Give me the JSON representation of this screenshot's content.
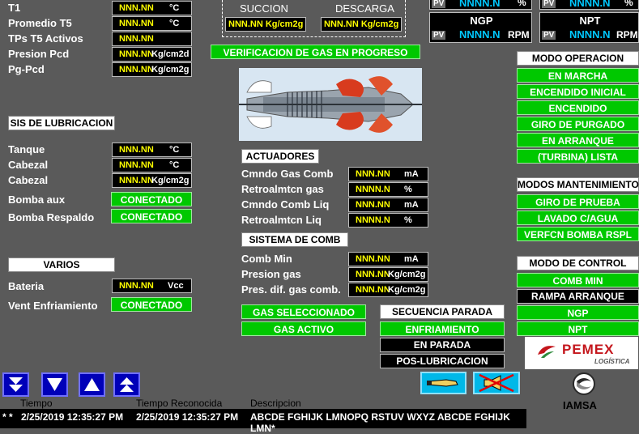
{
  "top_left": {
    "rows": [
      {
        "label": "T1",
        "value": "NNN.NN",
        "unit": "°C"
      },
      {
        "label": "Promedio   T5",
        "value": "NNN.NN",
        "unit": "°C"
      },
      {
        "label": "TPs   T5   Activos",
        "value": "NNN.NN",
        "unit": ""
      },
      {
        "label": "Presion    Pcd",
        "value": "NNN.NN",
        "unit": "Kg/cm2d"
      },
      {
        "label": "Pg-Pcd",
        "value": "NNN.NN",
        "unit": "Kg/cm2g"
      }
    ]
  },
  "pressures": {
    "suction_label": "SUCCION",
    "suction_value": "NNN.NN Kg/cm2g",
    "discharge_label": "DESCARGA",
    "discharge_value": "NNN.NN Kg/cm2g",
    "status": "VERIFICACION DE GAS EN PROGRESO"
  },
  "speeds": {
    "pv": "PV",
    "top_left_value": "NNNN.N",
    "top_left_unit": "%",
    "top_right_value": "NNNN.N",
    "top_right_unit": "%",
    "ngp_label": "NGP",
    "ngp_value": "NNNN.N",
    "ngp_unit": "RPM",
    "npt_label": "NPT",
    "npt_value": "NNNN.N",
    "npt_unit": "RPM"
  },
  "lubrication": {
    "title": "SIS DE LUBRICACION",
    "rows": [
      {
        "label": "Tanque",
        "value": "NNN.NN",
        "unit": "°C"
      },
      {
        "label": "Cabezal",
        "value": "NNN.NN",
        "unit": "°C"
      },
      {
        "label": "Cabezal",
        "value": "NNN.NN",
        "unit": "Kg/cm2g"
      }
    ],
    "bomba_aux_label": "Bomba aux",
    "bomba_aux_state": "CONECTADO",
    "bomba_resp_label": "Bomba Respaldo",
    "bomba_resp_state": "CONECTADO"
  },
  "varios": {
    "title": "VARIOS",
    "bateria_label": "Bateria",
    "bateria_value": "NNN.NN",
    "bateria_unit": "Vcc",
    "vent_label": "Vent Enfriamiento",
    "vent_state": "CONECTADO"
  },
  "actuadores": {
    "title": "ACTUADORES",
    "rows": [
      {
        "label": "Cmndo Gas Comb",
        "value": "NNN.NN",
        "unit": "mA"
      },
      {
        "label": "Retroalmtcn gas",
        "value": "NNNN.N",
        "unit": "%"
      },
      {
        "label": "Cmndo Comb Liq",
        "value": "NNN.NN",
        "unit": "mA"
      },
      {
        "label": "Retroalmtcn Liq",
        "value": "NNNN.N",
        "unit": "%"
      }
    ]
  },
  "sistema_comb": {
    "title": "SISTEMA DE COMB",
    "rows": [
      {
        "label": "Comb  Min",
        "value": "NNN.NN",
        "unit": "mA"
      },
      {
        "label": "Presion  gas",
        "value": "NNN.NN",
        "unit": "Kg/cm2g"
      },
      {
        "label": "Pres. dif. gas comb.",
        "value": "NNN.NN",
        "unit": "Kg/cm2g"
      }
    ]
  },
  "gas_buttons": {
    "seleccionado": "GAS SELECCIONADO",
    "activo": "GAS ACTIVO"
  },
  "secuencia": {
    "title": "SECUENCIA PARADA",
    "items": [
      "ENFRIAMIENTO",
      "EN PARADA",
      "POS-LUBRICACION"
    ]
  },
  "modo_operacion": {
    "title": "MODO OPERACION",
    "items": [
      "EN MARCHA",
      "ENCENDIDO INICIAL",
      "ENCENDIDO",
      "GIRO DE PURGADO",
      "EN ARRANQUE",
      "(TURBINA) LISTA"
    ]
  },
  "modos_mantenimiento": {
    "title": "MODOS MANTENIMIENTO",
    "items": [
      "GIRO DE PRUEBA",
      "LAVADO C/AGUA",
      "VERFCN BOMBA RSPL"
    ]
  },
  "modo_control": {
    "title": "MODO DE CONTROL",
    "items": [
      "COMB MIN",
      "RAMPA ARRANQUE",
      "NGP",
      "NPT"
    ]
  },
  "logos": {
    "pemex": "PEMEX",
    "pemex_sub": "LOGÍSTICA",
    "iamsa": "IAMSA"
  },
  "alarms": {
    "headers": [
      "Tiempo",
      "Tiempo Reconocida",
      "Descripcion"
    ],
    "row": {
      "marker": "*  *",
      "time": "2/25/2019 12:35:27 PM",
      "ack": "2/25/2019 12:35:27 PM",
      "desc": "ABCDE FGHIJK LMNOPQ RSTUV WXYZ ABCDE FGHIJK LMN*"
    }
  },
  "colors": {
    "background": "#5a5a5a",
    "value_text": "#ffff00",
    "active_green": "#00c800",
    "nav_blue": "#0000b8"
  }
}
